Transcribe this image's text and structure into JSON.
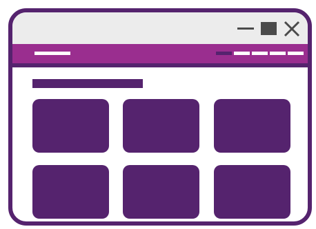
{
  "window": {
    "controls": [
      "minimize-icon",
      "maximize-icon",
      "close-icon"
    ]
  },
  "navbar": {
    "item_count": 5,
    "active_item_index": 0
  },
  "content": {
    "tile_grid": {
      "rows": 2,
      "columns": 3
    }
  },
  "colors": {
    "frame": "#55236e",
    "navbar": "#9a2e8f",
    "titlebar": "#ececec",
    "controls": "#4a4a4a",
    "placeholder": "#ffffff"
  }
}
